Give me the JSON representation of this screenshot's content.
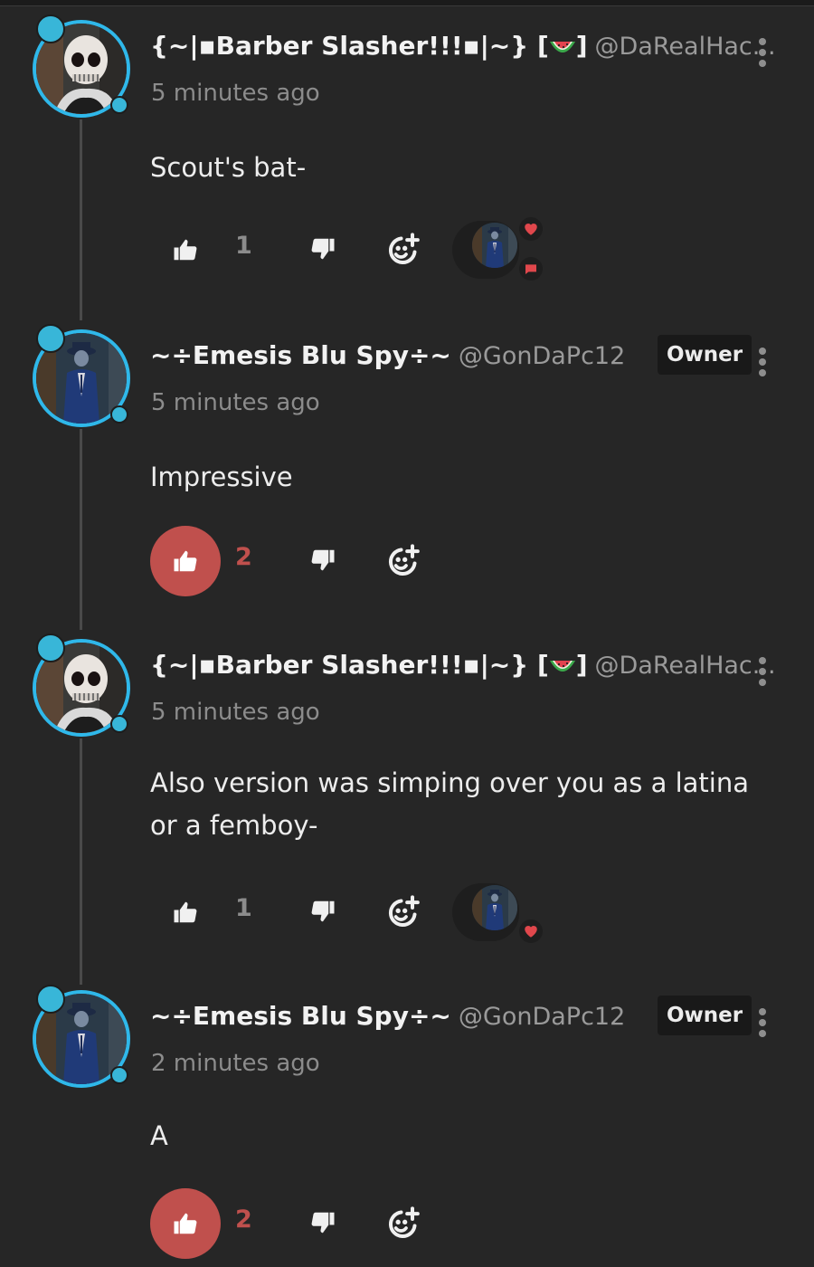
{
  "comments": [
    {
      "display_name": "{~|▪Barber Slasher!!!▪|~} [",
      "display_name_suffix": "]",
      "handle": "@DaRealHac...",
      "timestamp": "5 minutes ago",
      "text": "Scout's bat-",
      "likes": "1",
      "liked": false,
      "owner": false,
      "reactions": [
        "heart-icon",
        "chat-bubble-icon"
      ]
    },
    {
      "display_name": "~÷Emesis Blu Spy÷~",
      "handle": "@GonDaPc12",
      "owner_label": "Owner",
      "timestamp": "5 minutes ago",
      "text": "Impressive",
      "likes": "2",
      "liked": true,
      "owner": true
    },
    {
      "display_name": "{~|▪Barber Slasher!!!▪|~} [",
      "display_name_suffix": "]",
      "handle": "@DaRealHac...",
      "timestamp": "5 minutes ago",
      "text_lines": [
        "Also version was simping over you as a latina",
        "or a femboy-"
      ],
      "likes": "1",
      "liked": false,
      "owner": false,
      "reactions": [
        "heart-icon"
      ]
    },
    {
      "display_name": "~÷Emesis Blu Spy÷~",
      "handle": "@GonDaPc12",
      "owner_label": "Owner",
      "timestamp": "2 minutes ago",
      "text": "A",
      "likes": "2",
      "liked": true,
      "owner": true
    }
  ],
  "colors": {
    "background": "#262626",
    "accent_like": "#c0504d",
    "avatar_ring": "#2fb8ea",
    "muted_text": "#8c8c8c"
  }
}
